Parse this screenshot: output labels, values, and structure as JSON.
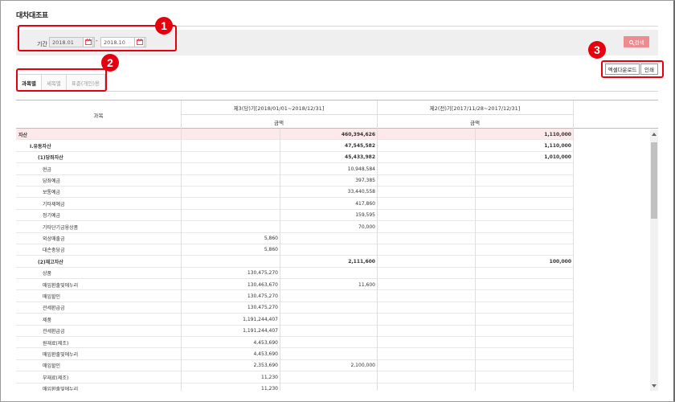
{
  "page": {
    "title": "대차대조표"
  },
  "filter": {
    "period_label": "기간",
    "start_date": "2018.01",
    "end_date": "2018.10",
    "separator": "-",
    "search_label": "검색"
  },
  "tabs": [
    {
      "label": "과목별",
      "active": true
    },
    {
      "label": "세목별",
      "active": false
    },
    {
      "label": "표준(개인)용",
      "active": false
    }
  ],
  "toolbar": {
    "excel_label": "엑셀다운로드",
    "print_label": "인쇄"
  },
  "callouts": [
    "1",
    "2",
    "3"
  ],
  "table": {
    "col_subject": "과목",
    "current_period": "제3(당)기[2018/01/01~2018/12/31]",
    "previous_period": "제2(전)기[2017/11/28~2017/12/31]",
    "amount_label": "금액",
    "rows": [
      {
        "name": "자산",
        "c1": "",
        "c2": "460,394,626",
        "c3": "",
        "c4": "1,110,000",
        "indent": 0,
        "bold": true
      },
      {
        "name": "Ⅰ.유동자산",
        "c1": "",
        "c2": "47,545,582",
        "c3": "",
        "c4": "1,110,000",
        "indent": 1,
        "bold": true
      },
      {
        "name": "(1)당좌자산",
        "c1": "",
        "c2": "45,433,982",
        "c3": "",
        "c4": "1,010,000",
        "indent": 2,
        "bold": true
      },
      {
        "name": "현금",
        "c1": "",
        "c2": "10,948,584",
        "c3": "",
        "c4": "",
        "indent": 3,
        "bold": false
      },
      {
        "name": "당좌예금",
        "c1": "",
        "c2": "397,385",
        "c3": "",
        "c4": "",
        "indent": 3,
        "bold": false
      },
      {
        "name": "보통예금",
        "c1": "",
        "c2": "33,440,558",
        "c3": "",
        "c4": "",
        "indent": 3,
        "bold": false
      },
      {
        "name": "기타제예금",
        "c1": "",
        "c2": "417,860",
        "c3": "",
        "c4": "",
        "indent": 3,
        "bold": false
      },
      {
        "name": "정기예금",
        "c1": "",
        "c2": "159,595",
        "c3": "",
        "c4": "",
        "indent": 3,
        "bold": false
      },
      {
        "name": "기타단기금융상품",
        "c1": "",
        "c2": "70,000",
        "c3": "",
        "c4": "",
        "indent": 3,
        "bold": false
      },
      {
        "name": "외상매출금",
        "c1": "5,860",
        "c2": "",
        "c3": "",
        "c4": "",
        "indent": 3,
        "bold": false
      },
      {
        "name": "대손충당금",
        "c1": "5,860",
        "c2": "",
        "c3": "",
        "c4": "",
        "indent": 3,
        "bold": false
      },
      {
        "name": "(2)재고자산",
        "c1": "",
        "c2": "2,111,600",
        "c3": "",
        "c4": "100,000",
        "indent": 2,
        "bold": true
      },
      {
        "name": "상품",
        "c1": "130,475,270",
        "c2": "",
        "c3": "",
        "c4": "",
        "indent": 3,
        "bold": false
      },
      {
        "name": "매입환출및에누리",
        "c1": "130,463,670",
        "c2": "11,600",
        "c3": "",
        "c4": "",
        "indent": 3,
        "bold": false
      },
      {
        "name": "매입할인",
        "c1": "130,475,270",
        "c2": "",
        "c3": "",
        "c4": "",
        "indent": 3,
        "bold": false
      },
      {
        "name": "관세환급금",
        "c1": "130,475,270",
        "c2": "",
        "c3": "",
        "c4": "",
        "indent": 3,
        "bold": false
      },
      {
        "name": "제품",
        "c1": "1,191,244,407",
        "c2": "",
        "c3": "",
        "c4": "",
        "indent": 3,
        "bold": false
      },
      {
        "name": "관세환급금",
        "c1": "1,191,244,407",
        "c2": "",
        "c3": "",
        "c4": "",
        "indent": 3,
        "bold": false
      },
      {
        "name": "원재료(제조)",
        "c1": "4,453,690",
        "c2": "",
        "c3": "",
        "c4": "",
        "indent": 3,
        "bold": false
      },
      {
        "name": "매입환출및에누리",
        "c1": "4,453,690",
        "c2": "",
        "c3": "",
        "c4": "",
        "indent": 3,
        "bold": false
      },
      {
        "name": "매입할인",
        "c1": "2,353,690",
        "c2": "2,100,000",
        "c3": "",
        "c4": "",
        "indent": 3,
        "bold": false
      },
      {
        "name": "부재료(제조)",
        "c1": "11,230",
        "c2": "",
        "c3": "",
        "c4": "",
        "indent": 3,
        "bold": false
      },
      {
        "name": "매입환출및에누리",
        "c1": "11,230",
        "c2": "",
        "c3": "",
        "c4": "",
        "indent": 3,
        "bold": false
      }
    ]
  }
}
